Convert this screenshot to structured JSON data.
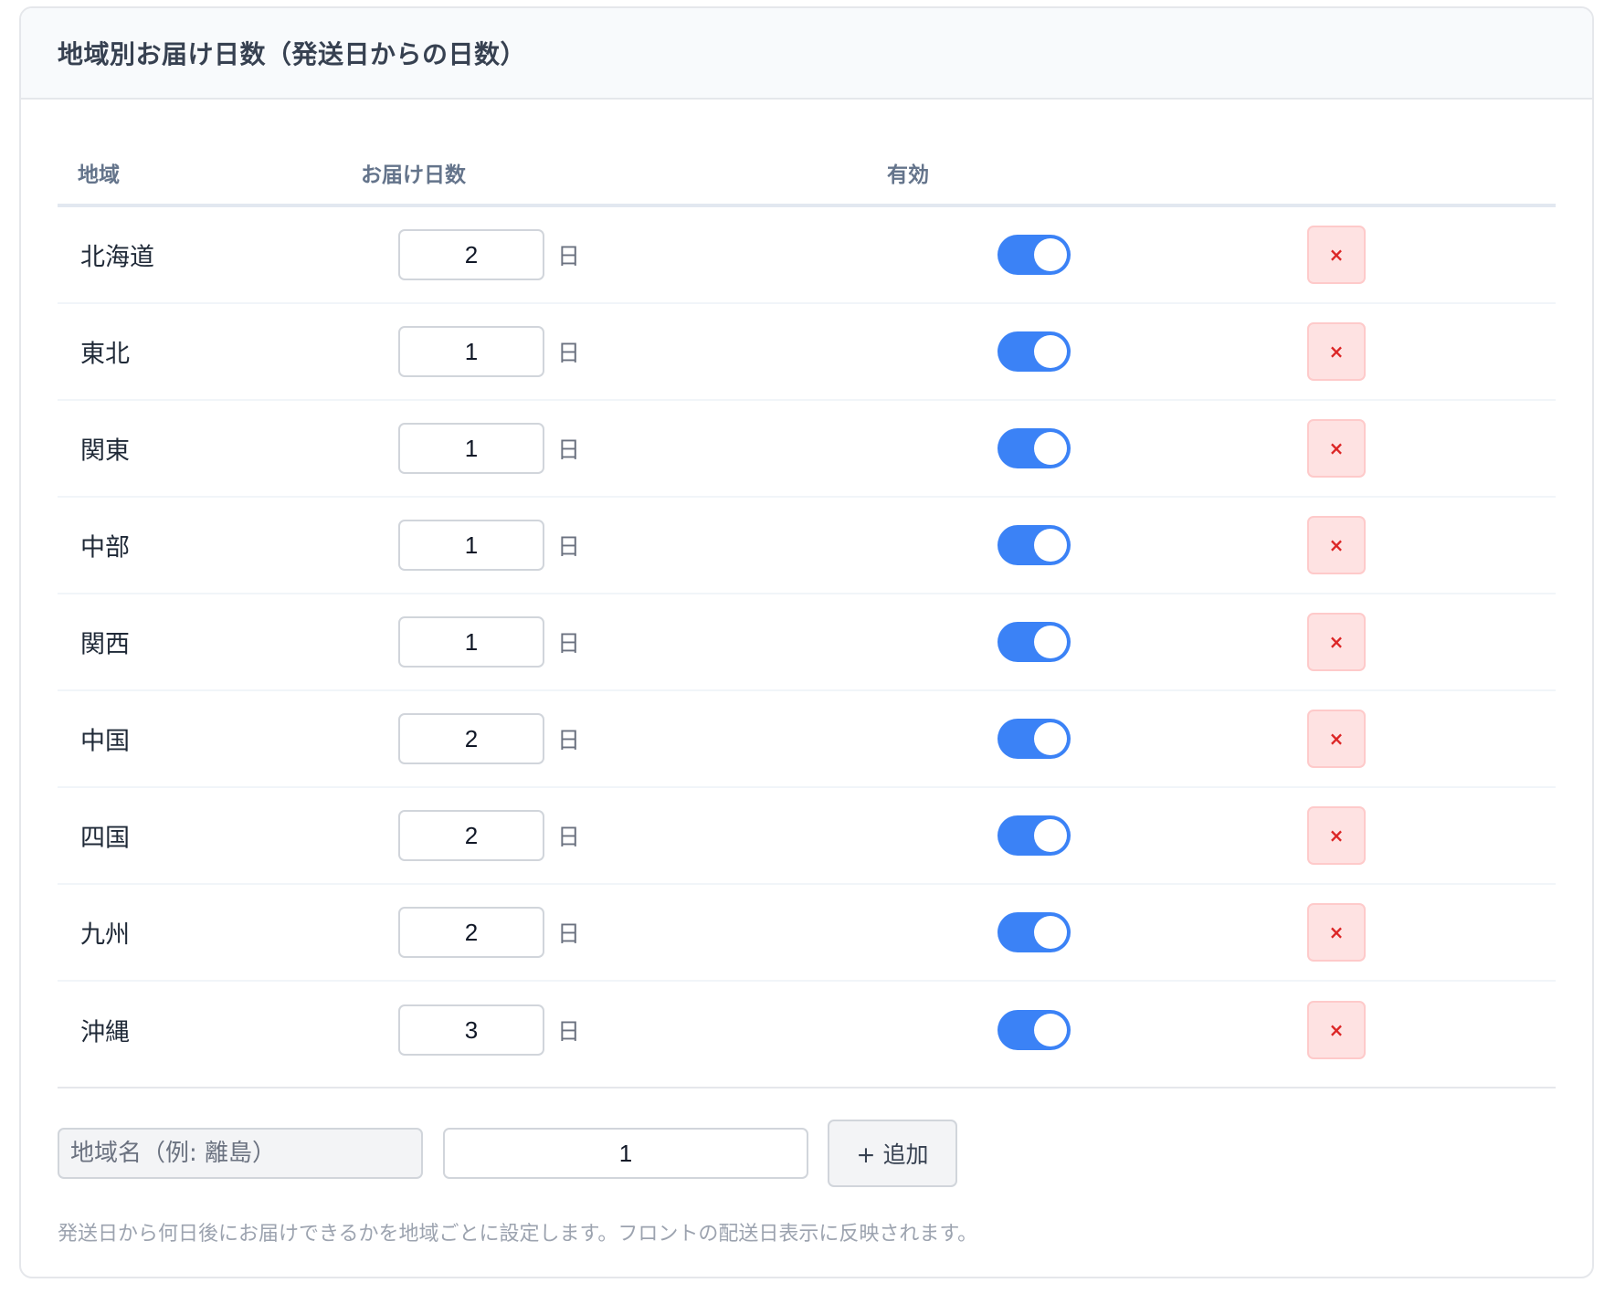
{
  "panel": {
    "title": "地域別お届け日数（発送日からの日数）"
  },
  "table": {
    "headers": {
      "region": "地域",
      "days": "お届け日数",
      "enabled": "有効"
    },
    "unit_label": "日",
    "delete_label": "×",
    "rows": [
      {
        "region": "北海道",
        "days": "2",
        "enabled": true
      },
      {
        "region": "東北",
        "days": "1",
        "enabled": true
      },
      {
        "region": "関東",
        "days": "1",
        "enabled": true
      },
      {
        "region": "中部",
        "days": "1",
        "enabled": true
      },
      {
        "region": "関西",
        "days": "1",
        "enabled": true
      },
      {
        "region": "中国",
        "days": "2",
        "enabled": true
      },
      {
        "region": "四国",
        "days": "2",
        "enabled": true
      },
      {
        "region": "九州",
        "days": "2",
        "enabled": true
      },
      {
        "region": "沖縄",
        "days": "3",
        "enabled": true
      }
    ]
  },
  "add_form": {
    "name_placeholder": "地域名（例: 離島）",
    "days_value": "1",
    "add_button_label": "+ 追加"
  },
  "help_text": "発送日から何日後にお届けできるかを地域ごとに設定します。フロントの配送日表示に反映されます。",
  "colors": {
    "toggle_on": "#3b82f6",
    "delete_bg": "#fee2e2",
    "delete_icon": "#dc2626"
  }
}
